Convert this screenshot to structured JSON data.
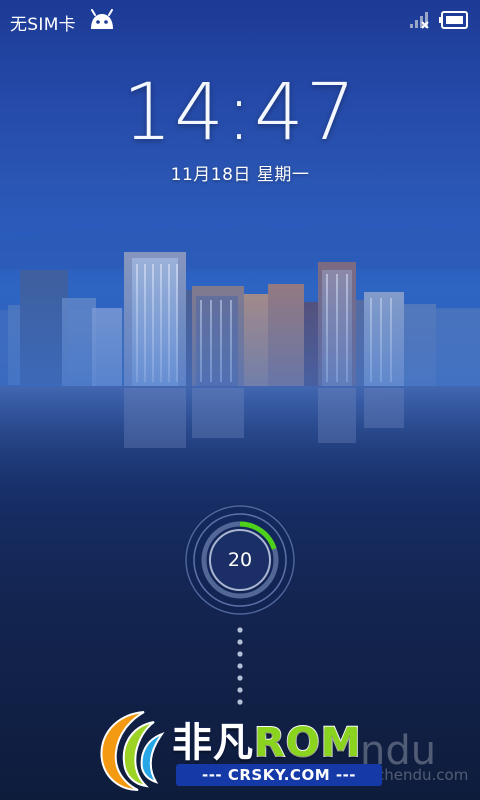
{
  "status_bar": {
    "carrier": "无SIM卡",
    "icons": [
      "android-icon",
      "signal-no-sim-icon",
      "battery-icon"
    ]
  },
  "lockscreen": {
    "time": "14:47",
    "date": "11月18日 星期一",
    "unlock_count": "20",
    "unlock_progress": 0.2
  },
  "watermark": {
    "brand_zh": "非凡",
    "brand_en": "ROM",
    "site": "--- CRSKY.COM ---",
    "ghost_text": "ndu",
    "ghost_site": "chendu.com"
  },
  "colors": {
    "ring_accent": "#4fd01a",
    "brand_green": "#8ad41f",
    "banner_blue": "#1639a8"
  }
}
